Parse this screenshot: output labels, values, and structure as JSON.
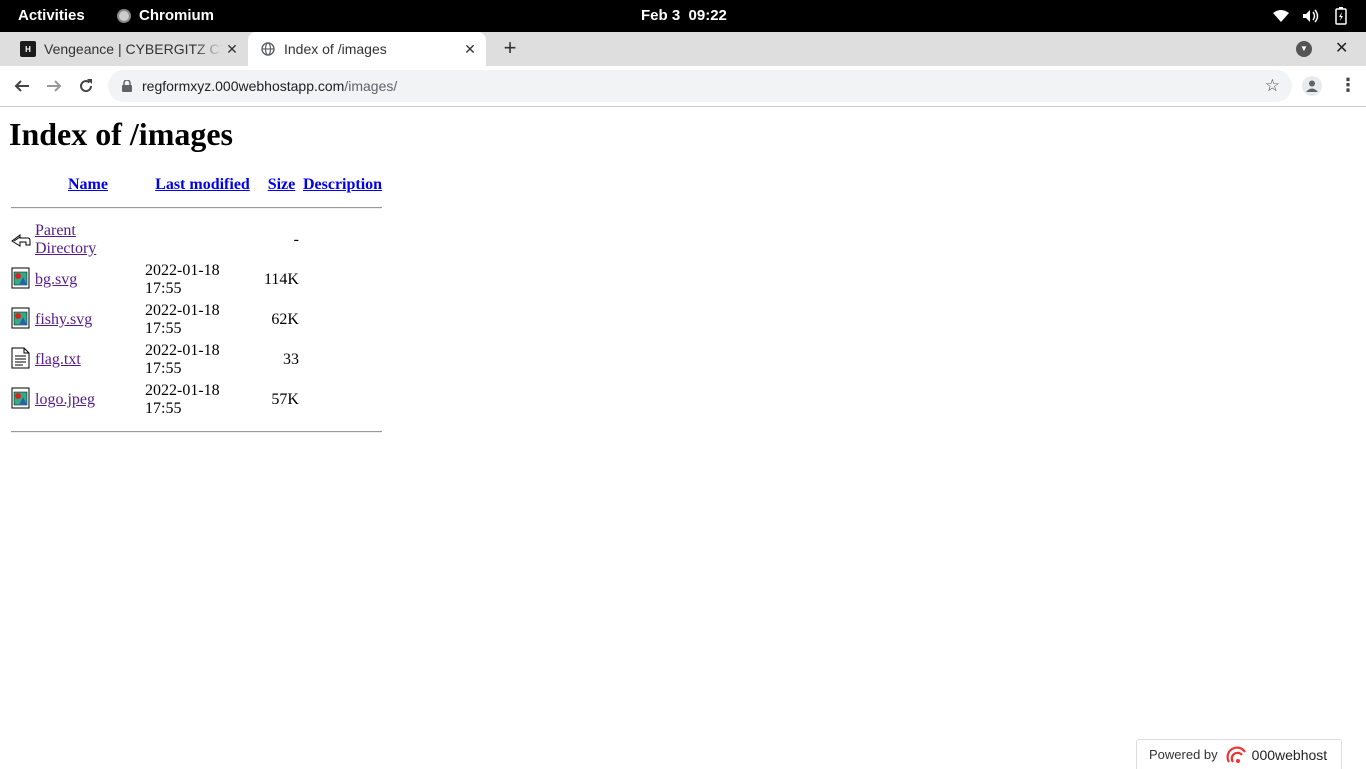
{
  "system_bar": {
    "activities": "Activities",
    "app_name": "Chromium",
    "clock": "Feb 3  09:22"
  },
  "tabs": [
    {
      "title": "Vengeance | CYBERGITZ CTF",
      "favicon": "cybergitz-logo"
    },
    {
      "title": "Index of /images",
      "favicon": "globe-icon",
      "active": true
    }
  ],
  "address_bar": {
    "host": "regformxyz.000webhostapp.com",
    "path": "/images/"
  },
  "page": {
    "heading": "Index of /images",
    "columns": [
      "Name",
      "Last modified",
      "Size",
      "Description"
    ],
    "rows": [
      {
        "icon": "back-icon",
        "name": "Parent Directory",
        "modified": "",
        "size": "-",
        "description": ""
      },
      {
        "icon": "image-icon",
        "name": "bg.svg",
        "modified": "2022-01-18 17:55",
        "size": "114K",
        "description": ""
      },
      {
        "icon": "image-icon",
        "name": "fishy.svg",
        "modified": "2022-01-18 17:55",
        "size": "62K",
        "description": ""
      },
      {
        "icon": "text-file-icon",
        "name": "flag.txt",
        "modified": "2022-01-18 17:55",
        "size": "33",
        "description": ""
      },
      {
        "icon": "image-icon",
        "name": "logo.jpeg",
        "modified": "2022-01-18 17:55",
        "size": "57K",
        "description": ""
      }
    ]
  },
  "footer_badge": {
    "label": "Powered by",
    "brand": "000webhost"
  }
}
